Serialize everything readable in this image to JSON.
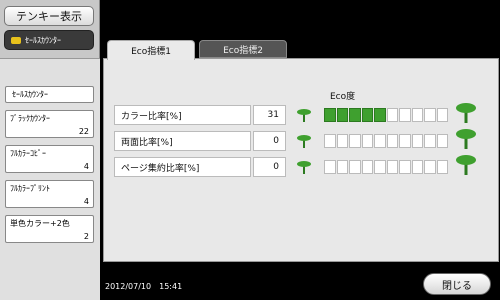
{
  "sidebar": {
    "tenkey_label": "テンキー表示",
    "sales_counter_button": "ｾｰﾙｽｶｳﾝﾀｰ",
    "counter_title": "ｾｰﾙｽｶｳﾝﾀｰ",
    "counters": [
      {
        "label": "ﾌﾞﾗｯｸｶｳﾝﾀｰ",
        "value": "22"
      },
      {
        "label": "ﾌﾙｶﾗｰｺﾋﾟｰ",
        "value": "4"
      },
      {
        "label": "ﾌﾙｶﾗｰﾌﾟﾘﾝﾄ",
        "value": "4"
      },
      {
        "label": "単色カラー+2色",
        "value": "2"
      }
    ]
  },
  "tabs": [
    {
      "label": "Eco指標1",
      "active": true
    },
    {
      "label": "Eco指標2",
      "active": false
    }
  ],
  "eco": {
    "header": "Eco度",
    "segments_total": 10,
    "rows": [
      {
        "label": "カラー比率[%]",
        "value": "31",
        "level": 5
      },
      {
        "label": "両面比率[%]",
        "value": "0",
        "level": 0
      },
      {
        "label": "ページ集約比率[%]",
        "value": "0",
        "level": 0
      }
    ],
    "accent": "#3fa02f"
  },
  "footer": {
    "datetime": "2012/07/10　15:41",
    "close_label": "閉じる"
  }
}
